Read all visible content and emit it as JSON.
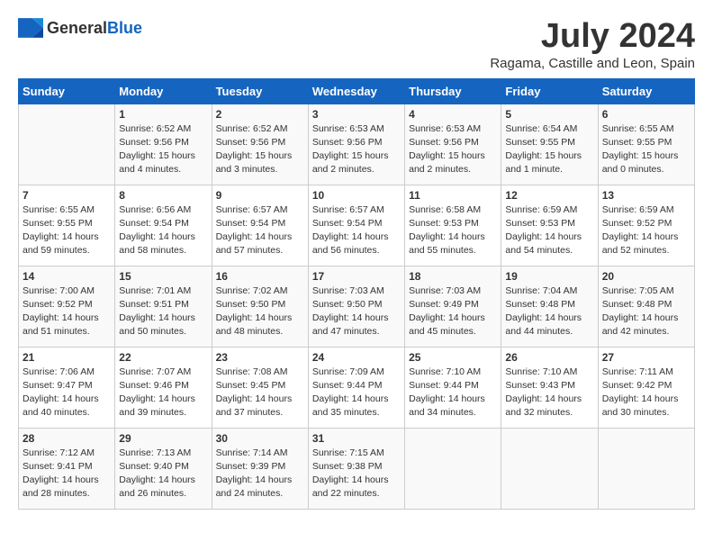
{
  "header": {
    "logo_general": "General",
    "logo_blue": "Blue",
    "month": "July 2024",
    "location": "Ragama, Castille and Leon, Spain"
  },
  "weekdays": [
    "Sunday",
    "Monday",
    "Tuesday",
    "Wednesday",
    "Thursday",
    "Friday",
    "Saturday"
  ],
  "weeks": [
    [
      {
        "day": "",
        "sunrise": "",
        "sunset": "",
        "daylight": ""
      },
      {
        "day": "1",
        "sunrise": "Sunrise: 6:52 AM",
        "sunset": "Sunset: 9:56 PM",
        "daylight": "Daylight: 15 hours and 4 minutes."
      },
      {
        "day": "2",
        "sunrise": "Sunrise: 6:52 AM",
        "sunset": "Sunset: 9:56 PM",
        "daylight": "Daylight: 15 hours and 3 minutes."
      },
      {
        "day": "3",
        "sunrise": "Sunrise: 6:53 AM",
        "sunset": "Sunset: 9:56 PM",
        "daylight": "Daylight: 15 hours and 2 minutes."
      },
      {
        "day": "4",
        "sunrise": "Sunrise: 6:53 AM",
        "sunset": "Sunset: 9:56 PM",
        "daylight": "Daylight: 15 hours and 2 minutes."
      },
      {
        "day": "5",
        "sunrise": "Sunrise: 6:54 AM",
        "sunset": "Sunset: 9:55 PM",
        "daylight": "Daylight: 15 hours and 1 minute."
      },
      {
        "day": "6",
        "sunrise": "Sunrise: 6:55 AM",
        "sunset": "Sunset: 9:55 PM",
        "daylight": "Daylight: 15 hours and 0 minutes."
      }
    ],
    [
      {
        "day": "7",
        "sunrise": "Sunrise: 6:55 AM",
        "sunset": "Sunset: 9:55 PM",
        "daylight": "Daylight: 14 hours and 59 minutes."
      },
      {
        "day": "8",
        "sunrise": "Sunrise: 6:56 AM",
        "sunset": "Sunset: 9:54 PM",
        "daylight": "Daylight: 14 hours and 58 minutes."
      },
      {
        "day": "9",
        "sunrise": "Sunrise: 6:57 AM",
        "sunset": "Sunset: 9:54 PM",
        "daylight": "Daylight: 14 hours and 57 minutes."
      },
      {
        "day": "10",
        "sunrise": "Sunrise: 6:57 AM",
        "sunset": "Sunset: 9:54 PM",
        "daylight": "Daylight: 14 hours and 56 minutes."
      },
      {
        "day": "11",
        "sunrise": "Sunrise: 6:58 AM",
        "sunset": "Sunset: 9:53 PM",
        "daylight": "Daylight: 14 hours and 55 minutes."
      },
      {
        "day": "12",
        "sunrise": "Sunrise: 6:59 AM",
        "sunset": "Sunset: 9:53 PM",
        "daylight": "Daylight: 14 hours and 54 minutes."
      },
      {
        "day": "13",
        "sunrise": "Sunrise: 6:59 AM",
        "sunset": "Sunset: 9:52 PM",
        "daylight": "Daylight: 14 hours and 52 minutes."
      }
    ],
    [
      {
        "day": "14",
        "sunrise": "Sunrise: 7:00 AM",
        "sunset": "Sunset: 9:52 PM",
        "daylight": "Daylight: 14 hours and 51 minutes."
      },
      {
        "day": "15",
        "sunrise": "Sunrise: 7:01 AM",
        "sunset": "Sunset: 9:51 PM",
        "daylight": "Daylight: 14 hours and 50 minutes."
      },
      {
        "day": "16",
        "sunrise": "Sunrise: 7:02 AM",
        "sunset": "Sunset: 9:50 PM",
        "daylight": "Daylight: 14 hours and 48 minutes."
      },
      {
        "day": "17",
        "sunrise": "Sunrise: 7:03 AM",
        "sunset": "Sunset: 9:50 PM",
        "daylight": "Daylight: 14 hours and 47 minutes."
      },
      {
        "day": "18",
        "sunrise": "Sunrise: 7:03 AM",
        "sunset": "Sunset: 9:49 PM",
        "daylight": "Daylight: 14 hours and 45 minutes."
      },
      {
        "day": "19",
        "sunrise": "Sunrise: 7:04 AM",
        "sunset": "Sunset: 9:48 PM",
        "daylight": "Daylight: 14 hours and 44 minutes."
      },
      {
        "day": "20",
        "sunrise": "Sunrise: 7:05 AM",
        "sunset": "Sunset: 9:48 PM",
        "daylight": "Daylight: 14 hours and 42 minutes."
      }
    ],
    [
      {
        "day": "21",
        "sunrise": "Sunrise: 7:06 AM",
        "sunset": "Sunset: 9:47 PM",
        "daylight": "Daylight: 14 hours and 40 minutes."
      },
      {
        "day": "22",
        "sunrise": "Sunrise: 7:07 AM",
        "sunset": "Sunset: 9:46 PM",
        "daylight": "Daylight: 14 hours and 39 minutes."
      },
      {
        "day": "23",
        "sunrise": "Sunrise: 7:08 AM",
        "sunset": "Sunset: 9:45 PM",
        "daylight": "Daylight: 14 hours and 37 minutes."
      },
      {
        "day": "24",
        "sunrise": "Sunrise: 7:09 AM",
        "sunset": "Sunset: 9:44 PM",
        "daylight": "Daylight: 14 hours and 35 minutes."
      },
      {
        "day": "25",
        "sunrise": "Sunrise: 7:10 AM",
        "sunset": "Sunset: 9:44 PM",
        "daylight": "Daylight: 14 hours and 34 minutes."
      },
      {
        "day": "26",
        "sunrise": "Sunrise: 7:10 AM",
        "sunset": "Sunset: 9:43 PM",
        "daylight": "Daylight: 14 hours and 32 minutes."
      },
      {
        "day": "27",
        "sunrise": "Sunrise: 7:11 AM",
        "sunset": "Sunset: 9:42 PM",
        "daylight": "Daylight: 14 hours and 30 minutes."
      }
    ],
    [
      {
        "day": "28",
        "sunrise": "Sunrise: 7:12 AM",
        "sunset": "Sunset: 9:41 PM",
        "daylight": "Daylight: 14 hours and 28 minutes."
      },
      {
        "day": "29",
        "sunrise": "Sunrise: 7:13 AM",
        "sunset": "Sunset: 9:40 PM",
        "daylight": "Daylight: 14 hours and 26 minutes."
      },
      {
        "day": "30",
        "sunrise": "Sunrise: 7:14 AM",
        "sunset": "Sunset: 9:39 PM",
        "daylight": "Daylight: 14 hours and 24 minutes."
      },
      {
        "day": "31",
        "sunrise": "Sunrise: 7:15 AM",
        "sunset": "Sunset: 9:38 PM",
        "daylight": "Daylight: 14 hours and 22 minutes."
      },
      {
        "day": "",
        "sunrise": "",
        "sunset": "",
        "daylight": ""
      },
      {
        "day": "",
        "sunrise": "",
        "sunset": "",
        "daylight": ""
      },
      {
        "day": "",
        "sunrise": "",
        "sunset": "",
        "daylight": ""
      }
    ]
  ]
}
